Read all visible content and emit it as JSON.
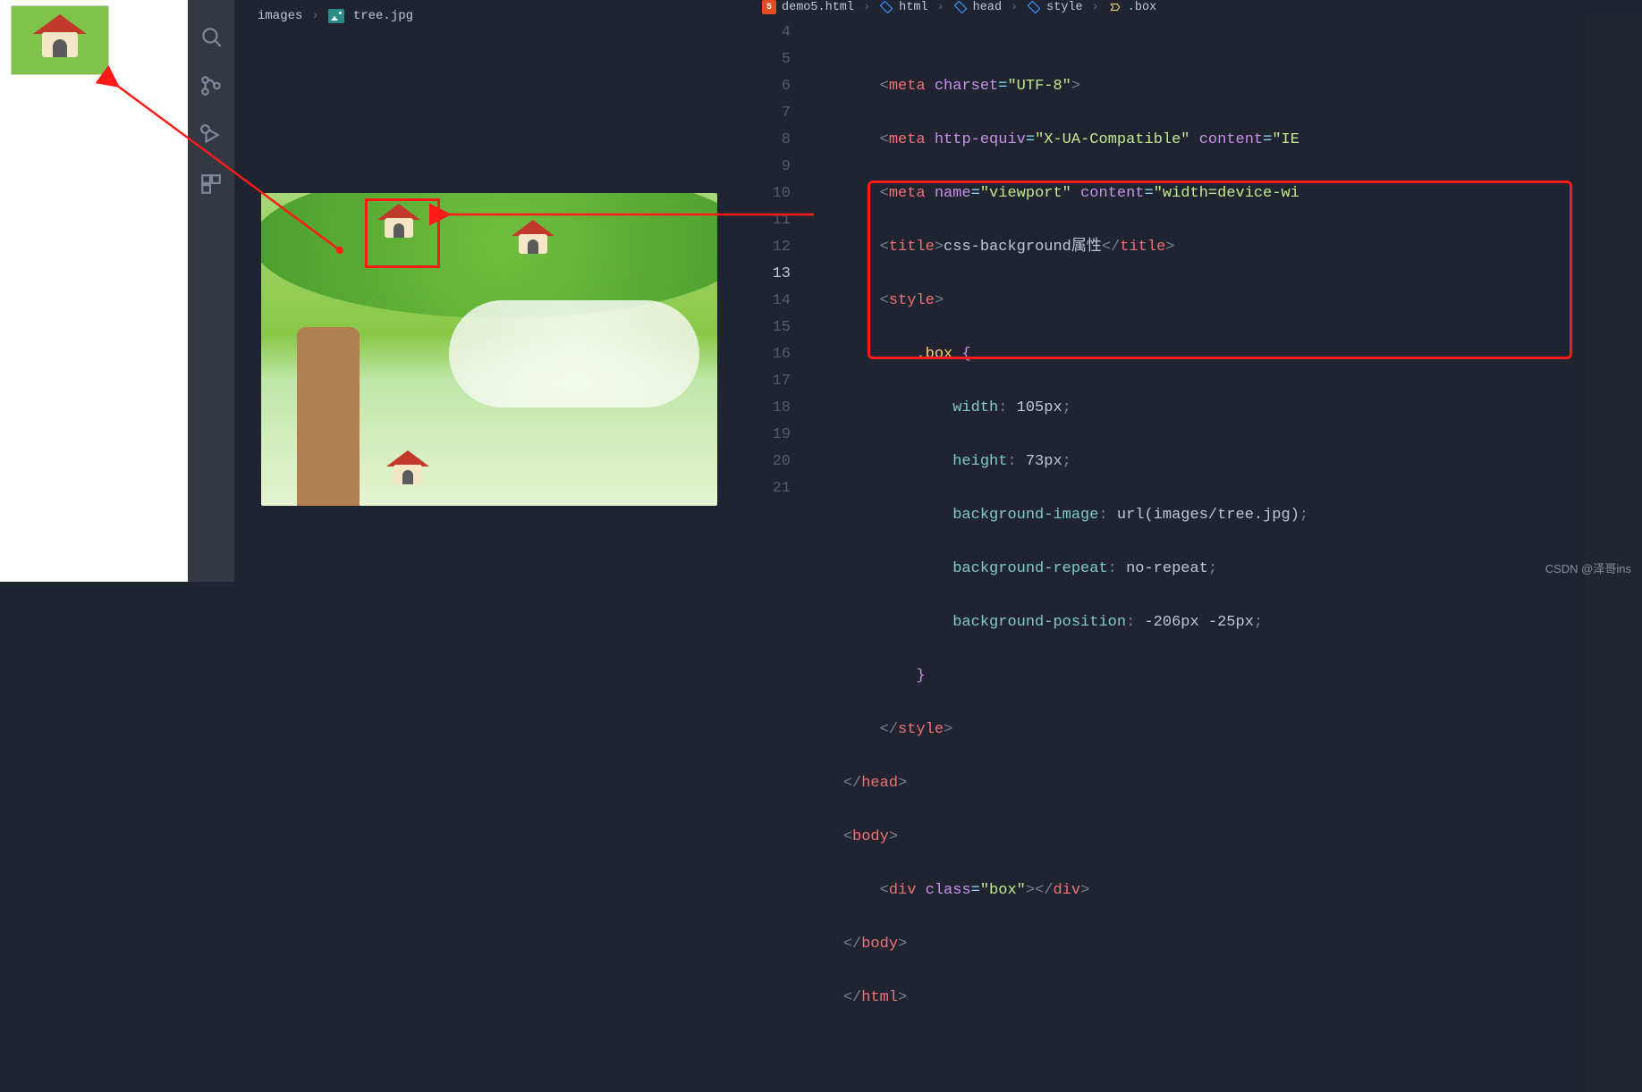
{
  "left_tab": {
    "folder": "images",
    "file": "tree.jpg"
  },
  "breadcrumbs": [
    "demo5.html",
    "html",
    "head",
    "style",
    ".box"
  ],
  "gutter": [
    "4",
    "5",
    "6",
    "7",
    "8",
    "9",
    "10",
    "11",
    "12",
    "13",
    "14",
    "15",
    "16",
    "17",
    "18",
    "19",
    "20",
    "21"
  ],
  "code": {
    "l4": {
      "tag": "meta",
      "a1": "charset",
      "v1": "\"UTF-8\""
    },
    "l5": {
      "tag": "meta",
      "a1": "http-equiv",
      "v1": "\"X-UA-Compatible\"",
      "a2": "content",
      "v2": "\"IE"
    },
    "l6": {
      "tag": "meta",
      "a1": "name",
      "v1": "\"viewport\"",
      "a2": "content",
      "v2": "\"width=device-wi"
    },
    "l7": {
      "tag": "title",
      "text": "css-background属性"
    },
    "l8": {
      "tag": "style"
    },
    "l9": {
      "sel": ".box"
    },
    "l10": {
      "prop": "width",
      "val": "105px"
    },
    "l11": {
      "prop": "height",
      "val": "73px"
    },
    "l12": {
      "prop": "background-image",
      "val": "url(images/tree.jpg)"
    },
    "l13": {
      "prop": "background-repeat",
      "val": "no-repeat"
    },
    "l14": {
      "prop": "background-position",
      "val": "-206px -25px"
    },
    "l17": {
      "tag": "head"
    },
    "l18": {
      "tag": "body"
    },
    "l19": {
      "tag": "div",
      "a1": "class",
      "v1": "\"box\""
    },
    "l20": {
      "tag": "body"
    },
    "l21": {
      "tag": "html"
    }
  },
  "watermark": "CSDN @泽哥ins"
}
